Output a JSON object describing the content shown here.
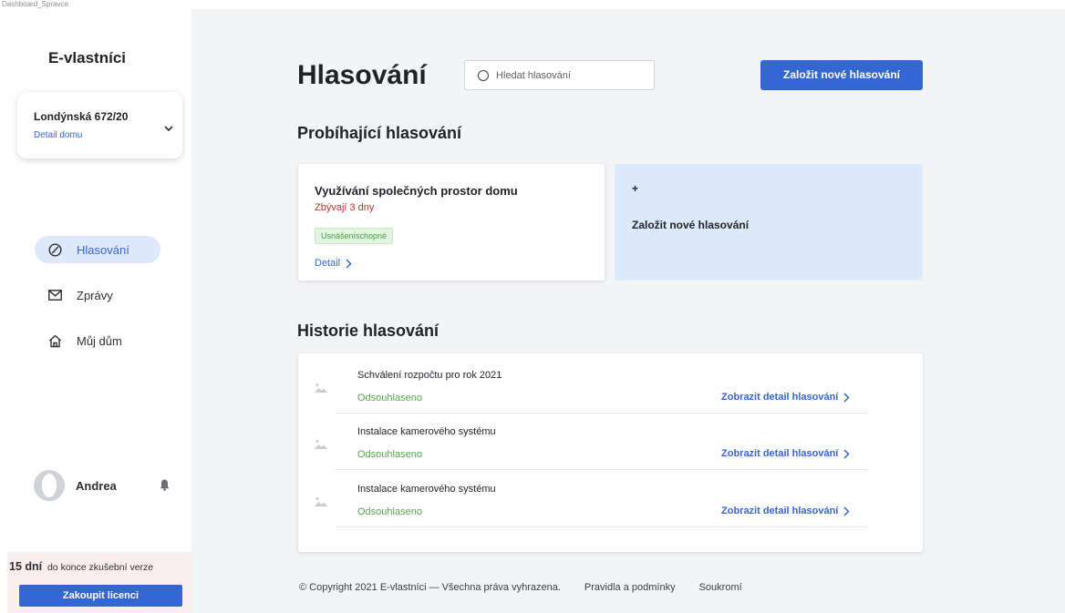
{
  "frame_label": "Dashboard_Spravce",
  "app": {
    "logo": "E-vlastníci"
  },
  "house": {
    "name": "Londýnská 672/20",
    "detail_label": "Detail domu"
  },
  "nav": {
    "items": [
      {
        "label": "Hlasování",
        "icon": "vote-circle-icon",
        "active": true
      },
      {
        "label": "Zprávy",
        "icon": "envelope-icon",
        "active": false
      },
      {
        "label": "Můj dům",
        "icon": "house-icon",
        "active": false
      }
    ]
  },
  "user": {
    "name": "Andrea"
  },
  "trial": {
    "days": "15 dní",
    "text": "do konce zkušební verze",
    "button": "Zakoupit licenci"
  },
  "header": {
    "title": "Hlasování",
    "search_placeholder": "Hledat hlasování",
    "new_button": "Založit nové hlasování"
  },
  "ongoing": {
    "title": "Probíhající hlasování",
    "card": {
      "title": "Využívání společných prostor domu",
      "remaining": "Zbývají 3 dny",
      "badge": "Usnášeníschopné",
      "detail": "Detail"
    },
    "new_card": {
      "plus": "+",
      "label": "Založit nové hlasování"
    }
  },
  "history": {
    "title": "Historie hlasování",
    "rows": [
      {
        "title": "Schválení rozpočtu pro rok 2021",
        "status": "Odsouhlaseno",
        "link": "Zobrazit detail hlasování"
      },
      {
        "title": "Instalace kamerového systému",
        "status": "Odsouhlaseno",
        "link": "Zobrazit detail hlasování"
      },
      {
        "title": "Instalace kamerového systému",
        "status": "Odsouhlaseno",
        "link": "Zobrazit detail hlasování"
      }
    ]
  },
  "footer": {
    "copyright": "© Copyright 2021 E-vlastníci — Všechna práva vyhrazena.",
    "terms": "Pravidla a podmínky",
    "privacy": "Soukromí"
  },
  "colors": {
    "accent": "#3566d6",
    "danger": "#c53030",
    "success": "#52aa4a",
    "active_bg": "#dde8fb"
  }
}
